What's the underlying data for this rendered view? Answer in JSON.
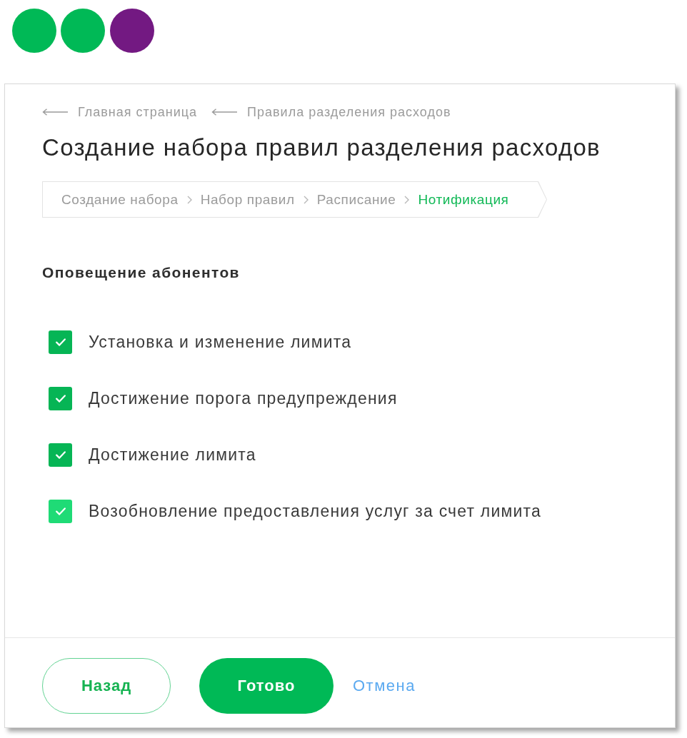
{
  "breadcrumbs": [
    {
      "label": "Главная страница"
    },
    {
      "label": "Правила разделения расходов"
    }
  ],
  "title": "Создание набора правил разделения расходов",
  "steps": [
    {
      "label": "Создание набора",
      "selected": false
    },
    {
      "label": "Набор правил",
      "selected": false
    },
    {
      "label": "Расписание",
      "selected": false
    },
    {
      "label": "Нотификация",
      "selected": true
    }
  ],
  "section": {
    "heading": "Оповещение абонентов",
    "options": [
      {
        "label": "Установка и изменение лимита",
        "checked": true,
        "color": "#06b555"
      },
      {
        "label": "Достижение порога предупреждения",
        "checked": true,
        "color": "#06b555"
      },
      {
        "label": "Достижение лимита",
        "checked": true,
        "color": "#06b555"
      },
      {
        "label": "Возобновление предоставления услуг за счет лимита",
        "checked": true,
        "color": "#1fdb76"
      }
    ]
  },
  "footer": {
    "buttons": [
      {
        "label": "Назад",
        "kind": "outline"
      },
      {
        "label": "Готово",
        "kind": "primary"
      },
      {
        "label": "Отмена",
        "kind": "link"
      }
    ]
  }
}
